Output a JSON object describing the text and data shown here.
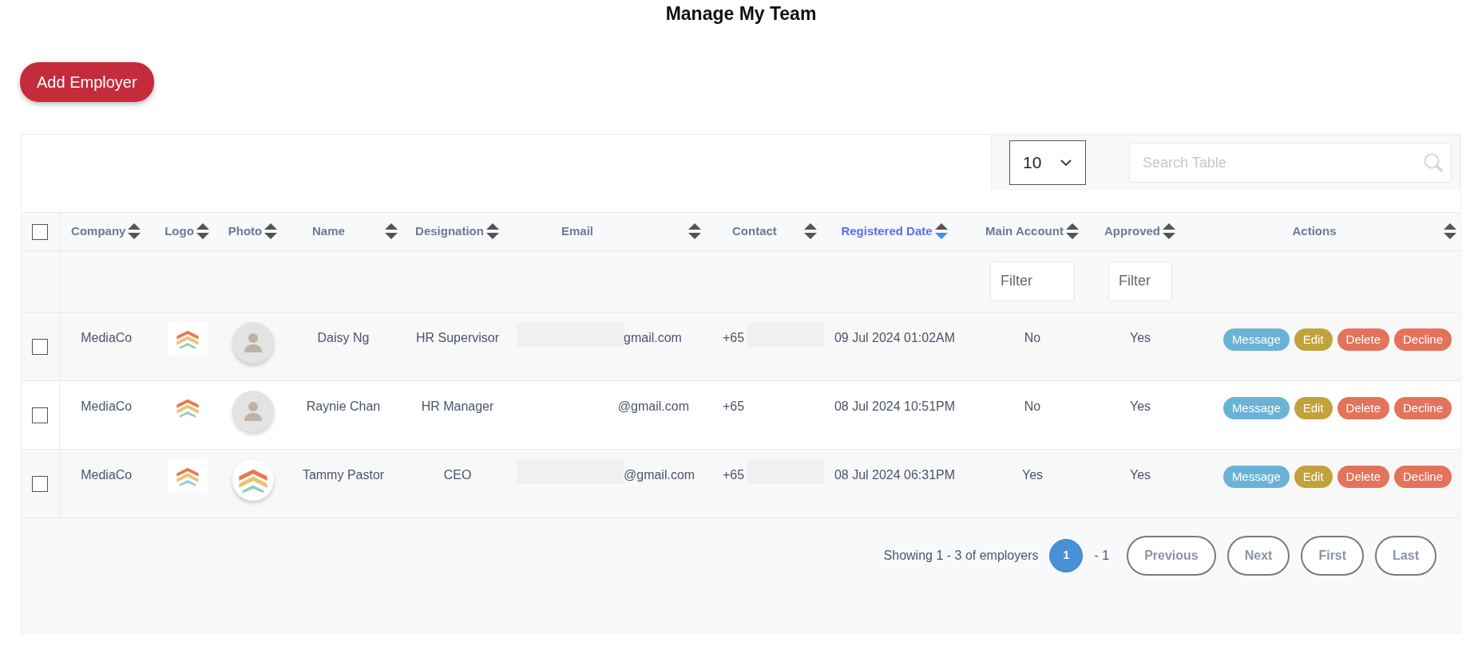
{
  "page": {
    "title": "Manage My Team"
  },
  "add_button": {
    "label": "Add Employer"
  },
  "page_size": {
    "value": "10"
  },
  "search": {
    "placeholder": "Search Table"
  },
  "table": {
    "select_all": {
      "checked": false
    },
    "columns": [
      {
        "label": "Company",
        "sorted": false
      },
      {
        "label": "Logo",
        "sorted": false
      },
      {
        "label": "Photo",
        "sorted": false
      },
      {
        "label": "Name",
        "sorted": false
      },
      {
        "label": "Designation",
        "sorted": false
      },
      {
        "label": "Email",
        "sorted": false
      },
      {
        "label": "Contact",
        "sorted": false
      },
      {
        "label": "Registered Date",
        "sorted": true
      },
      {
        "label": "Main Account",
        "sorted": false,
        "filter": {
          "placeholder": "Filter"
        }
      },
      {
        "label": "Approved",
        "sorted": false,
        "filter": {
          "placeholder": "Filter"
        }
      },
      {
        "label": "Actions",
        "sorted": false
      }
    ],
    "rows": [
      {
        "checked": false,
        "company": "MediaCo",
        "photo": {
          "kind": "avatar"
        },
        "name": "Daisy Ng",
        "designation": "HR Supervisor",
        "email": {
          "text": "gmail.com",
          "redacted": true
        },
        "contact": {
          "text": "+65",
          "redacted": true
        },
        "registered": "09 Jul 2024 01:02AM",
        "main_account": "No",
        "approved": "Yes",
        "actions": [
          {
            "label": "Message",
            "kind": "message"
          },
          {
            "label": "Edit",
            "kind": "edit"
          },
          {
            "label": "Delete",
            "kind": "delete"
          },
          {
            "label": "Decline",
            "kind": "decline"
          }
        ]
      },
      {
        "checked": false,
        "company": "MediaCo",
        "photo": {
          "kind": "avatar"
        },
        "name": "Raynie Chan",
        "designation": "HR Manager",
        "email": {
          "text": "@gmail.com",
          "redacted": false
        },
        "contact": {
          "text": "+65",
          "redacted": false
        },
        "registered": "08 Jul 2024 10:51PM",
        "main_account": "No",
        "approved": "Yes",
        "actions": [
          {
            "label": "Message",
            "kind": "message"
          },
          {
            "label": "Edit",
            "kind": "edit"
          },
          {
            "label": "Delete",
            "kind": "delete"
          },
          {
            "label": "Decline",
            "kind": "decline"
          }
        ]
      },
      {
        "checked": false,
        "company": "MediaCo",
        "photo": {
          "kind": "logo"
        },
        "name": "Tammy Pastor",
        "designation": "CEO",
        "email": {
          "text": "@gmail.com",
          "redacted": true
        },
        "contact": {
          "text": "+65",
          "redacted": true
        },
        "registered": "08 Jul 2024 06:31PM",
        "main_account": "Yes",
        "approved": "Yes",
        "actions": [
          {
            "label": "Message",
            "kind": "message"
          },
          {
            "label": "Edit",
            "kind": "edit"
          },
          {
            "label": "Delete",
            "kind": "delete"
          },
          {
            "label": "Decline",
            "kind": "decline"
          }
        ]
      }
    ]
  },
  "pagination": {
    "summary": "Showing 1 - 3 of employers",
    "pages": [
      {
        "label": "1",
        "selected": true
      }
    ],
    "page_suffix": "- 1",
    "buttons": [
      {
        "label": "Previous"
      },
      {
        "label": "Next"
      },
      {
        "label": "First"
      },
      {
        "label": "Last"
      }
    ]
  }
}
